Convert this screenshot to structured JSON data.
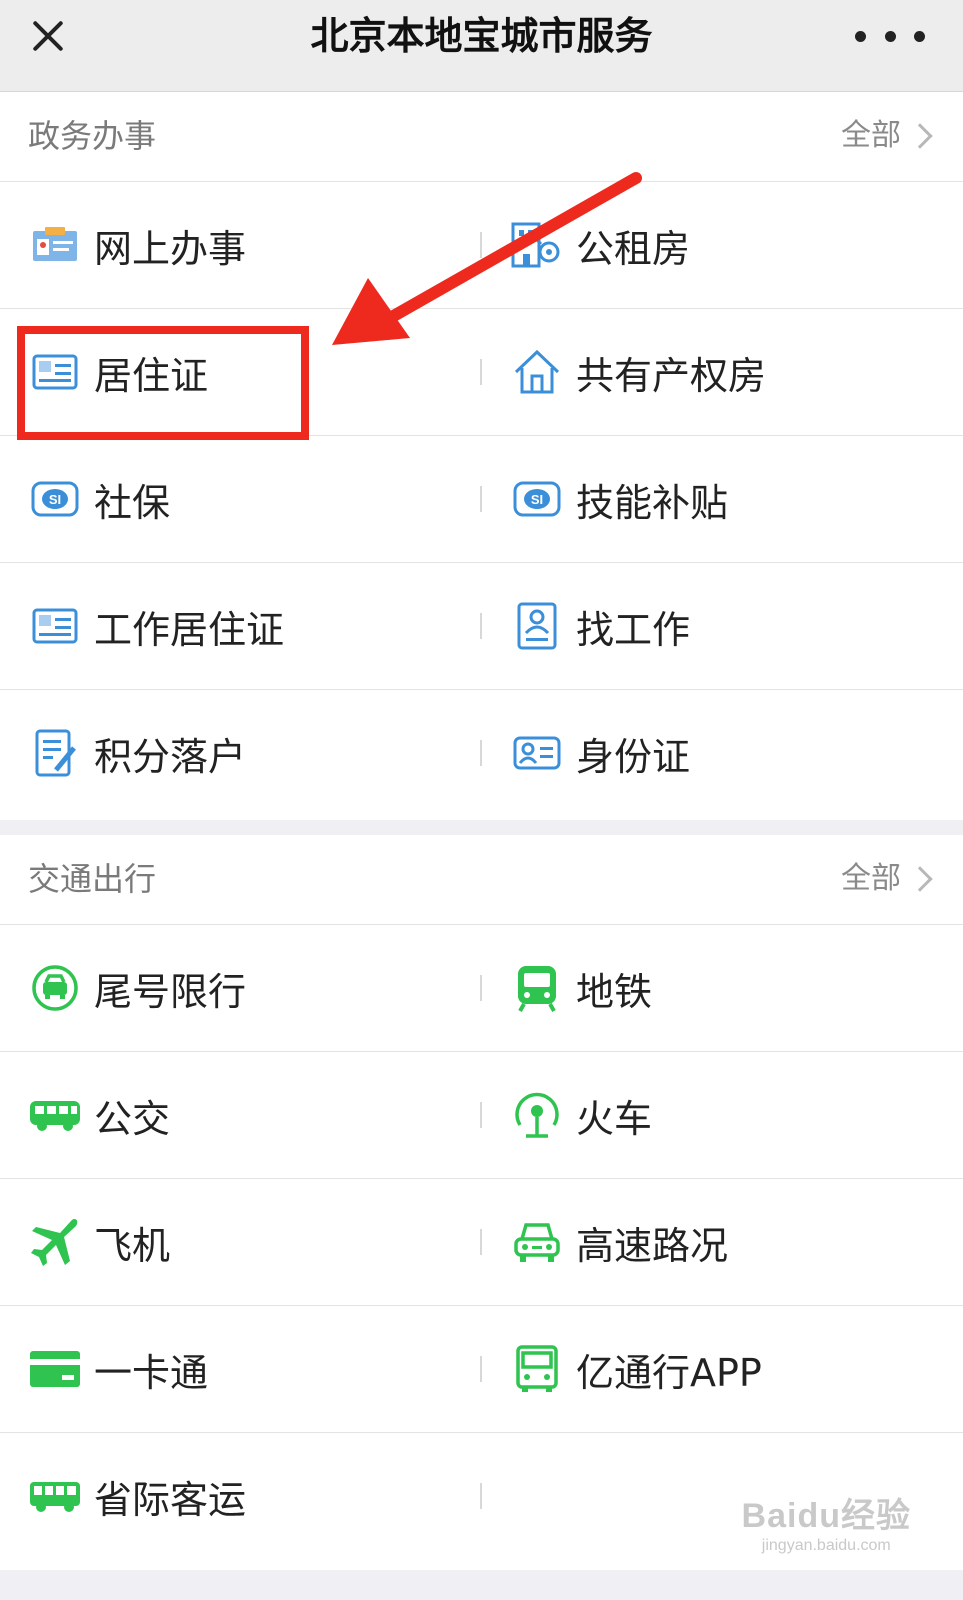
{
  "header": {
    "title": "北京本地宝城市服务"
  },
  "gov": {
    "title": "政务办事",
    "all": "全部",
    "items": [
      {
        "label": "网上办事",
        "icon": "id-card-icon"
      },
      {
        "label": "公租房",
        "icon": "building-key-icon"
      },
      {
        "label": "居住证",
        "icon": "residence-card-icon"
      },
      {
        "label": "共有产权房",
        "icon": "house-icon"
      },
      {
        "label": "社保",
        "icon": "social-security-icon"
      },
      {
        "label": "技能补贴",
        "icon": "social-security-icon"
      },
      {
        "label": "工作居住证",
        "icon": "residence-card-icon"
      },
      {
        "label": "找工作",
        "icon": "resume-icon"
      },
      {
        "label": "积分落户",
        "icon": "edit-document-icon"
      },
      {
        "label": "身份证",
        "icon": "identity-card-icon"
      }
    ]
  },
  "traffic": {
    "title": "交通出行",
    "all": "全部",
    "items": [
      {
        "label": "尾号限行",
        "icon": "car-restriction-icon"
      },
      {
        "label": "地铁",
        "icon": "subway-icon"
      },
      {
        "label": "公交",
        "icon": "bus-icon"
      },
      {
        "label": "火车",
        "icon": "train-icon"
      },
      {
        "label": "飞机",
        "icon": "airplane-icon"
      },
      {
        "label": "高速路况",
        "icon": "highway-car-icon"
      },
      {
        "label": "一卡通",
        "icon": "card-icon"
      },
      {
        "label": "亿通行APP",
        "icon": "app-bus-icon"
      },
      {
        "label": "省际客运",
        "icon": "coach-icon"
      }
    ]
  },
  "watermark": {
    "logo": "Baidu经验",
    "url": "jingyan.baidu.com"
  },
  "colors": {
    "highlight": "#ee2a1e",
    "gov_icon": "#3b8fd8",
    "traffic_icon": "#2fc34f"
  }
}
